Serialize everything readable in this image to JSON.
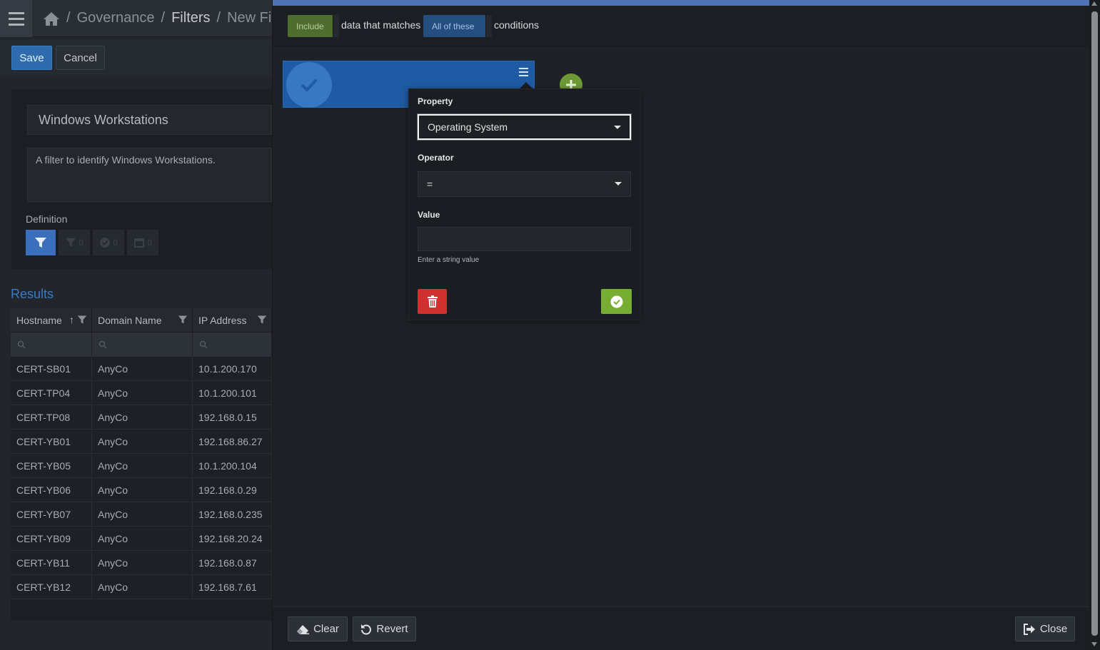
{
  "breadcrumb": {
    "home_icon": "home-icon",
    "items": [
      "Governance",
      "Filters",
      "New Fil"
    ]
  },
  "toolbar": {
    "save_label": "Save",
    "cancel_label": "Cancel"
  },
  "filter": {
    "name": "Windows Workstations",
    "description": "A filter to identify Windows Workstations.",
    "definition_label": "Definition",
    "tabs": [
      {
        "icon": "filter-icon",
        "count": ""
      },
      {
        "icon": "filter-icon",
        "count": "0"
      },
      {
        "icon": "check-circle-icon",
        "count": "0"
      },
      {
        "icon": "calendar-icon",
        "count": "0"
      }
    ]
  },
  "results": {
    "title": "Results",
    "columns": [
      "Hostname",
      "Domain Name",
      "IP Address"
    ],
    "rows": [
      [
        "CERT-SB01",
        "AnyCo",
        "10.1.200.170"
      ],
      [
        "CERT-TP04",
        "AnyCo",
        "10.1.200.101"
      ],
      [
        "CERT-TP08",
        "AnyCo",
        "192.168.0.15"
      ],
      [
        "CERT-YB01",
        "AnyCo",
        "192.168.86.27"
      ],
      [
        "CERT-YB05",
        "AnyCo",
        "10.1.200.104"
      ],
      [
        "CERT-YB06",
        "AnyCo",
        "192.168.0.29"
      ],
      [
        "CERT-YB07",
        "AnyCo",
        "192.168.0.235"
      ],
      [
        "CERT-YB09",
        "AnyCo",
        "192.168.20.24"
      ],
      [
        "CERT-YB11",
        "AnyCo",
        "192.168.0.87"
      ],
      [
        "CERT-YB12",
        "AnyCo",
        "192.168.7.61"
      ]
    ]
  },
  "conditions": {
    "include_label": "Include",
    "text1": "data that matches",
    "match_label": "All of these",
    "text2": "conditions"
  },
  "editor": {
    "property_label": "Property",
    "property_value": "Operating System",
    "operator_label": "Operator",
    "operator_value": "=",
    "value_label": "Value",
    "value_value": "",
    "value_hint": "Enter a string value"
  },
  "footer": {
    "clear_label": "Clear",
    "revert_label": "Revert",
    "close_label": "Close"
  },
  "colors": {
    "accent": "#4f73b5",
    "primary": "#2f6cae",
    "include": "#4f6d2e",
    "delete": "#d0302f",
    "confirm": "#78ad34"
  }
}
